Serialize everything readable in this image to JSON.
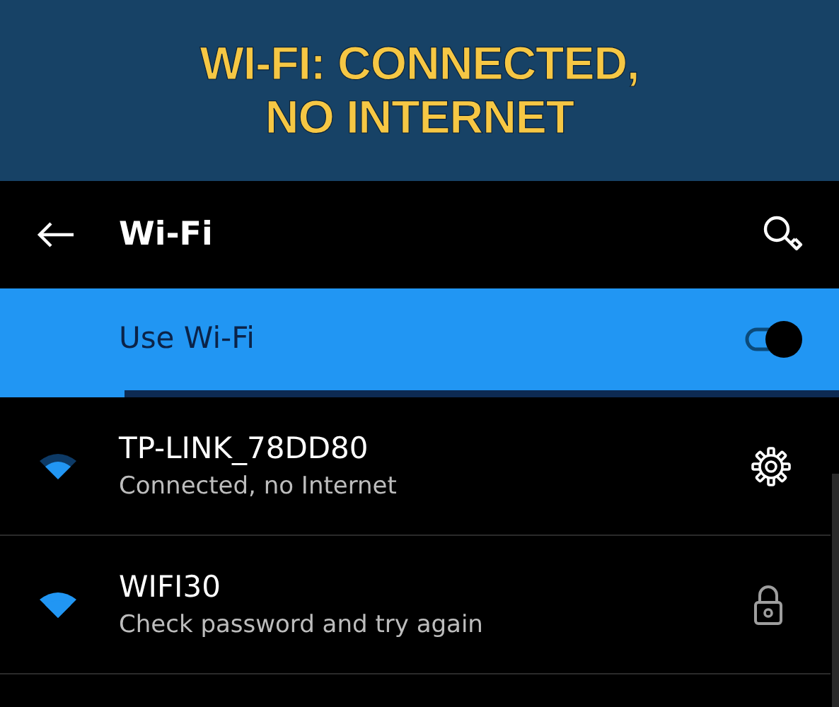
{
  "caption": "WI-FI: CONNECTED, NO INTERNET",
  "app_bar": {
    "title": "Wi-Fi"
  },
  "use_wifi": {
    "label": "Use Wi-Fi",
    "on": true
  },
  "networks": [
    {
      "ssid": "TP-LINK_78DD80",
      "status": "Connected, no Internet",
      "kind": "settings"
    },
    {
      "ssid": "WIFI30",
      "status": "Check password and try again",
      "kind": "locked"
    }
  ]
}
